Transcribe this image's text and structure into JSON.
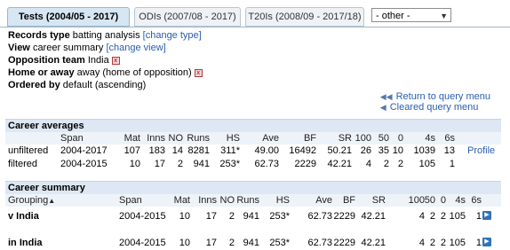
{
  "tabs": {
    "items": [
      {
        "label": "Tests (2004/05 - 2017)",
        "active": true
      },
      {
        "label": "ODIs (2007/08 - 2017)",
        "active": false
      },
      {
        "label": "T20Is (2008/09 - 2017/18)",
        "active": false
      }
    ],
    "select_value": "- other -"
  },
  "query": {
    "records_type_label": "Records type",
    "records_type_value": "batting analysis",
    "records_type_link": "[change type]",
    "view_label": "View",
    "view_value": "career summary",
    "view_link": "[change view]",
    "opposition_label": "Opposition team",
    "opposition_value": "India",
    "home_label": "Home or away",
    "home_value": "away (home of opposition)",
    "ordered_label": "Ordered by",
    "ordered_value": "default (ascending)",
    "return_link": "Return to query menu",
    "cleared_link": "Cleared query menu"
  },
  "career_averages": {
    "title": "Career averages",
    "columns": [
      "Span",
      "Mat",
      "Inns",
      "NO",
      "Runs",
      "HS",
      "Ave",
      "BF",
      "SR",
      "100",
      "50",
      "0",
      "4s",
      "6s"
    ],
    "rows": [
      {
        "label": "unfiltered",
        "values": [
          "2004-2017",
          "107",
          "183",
          "14",
          "8281",
          "311*",
          "49.00",
          "16492",
          "50.21",
          "26",
          "35",
          "10",
          "1039",
          "13"
        ],
        "profile": "Profile"
      },
      {
        "label": "filtered",
        "values": [
          "2004-2015",
          "10",
          "17",
          "2",
          "941",
          "253*",
          "62.73",
          "2229",
          "42.21",
          "4",
          "2",
          "2",
          "105",
          "1"
        ]
      }
    ]
  },
  "career_summary": {
    "title": "Career summary",
    "grouping_label": "Grouping",
    "columns": [
      "Span",
      "Mat",
      "Inns",
      "NO",
      "Runs",
      "HS",
      "Ave",
      "BF",
      "SR",
      "100",
      "50",
      "0",
      "4s",
      "6s"
    ],
    "rows": [
      {
        "label": "v India",
        "values": [
          "2004-2015",
          "10",
          "17",
          "2",
          "941",
          "253*",
          "62.73",
          "2229",
          "42.21",
          "4",
          "2",
          "2",
          "105",
          "1"
        ]
      },
      {
        "label": "in India",
        "values": [
          "2004-2015",
          "10",
          "17",
          "2",
          "941",
          "253*",
          "62.73",
          "2229",
          "42.21",
          "4",
          "2",
          "2",
          "105",
          "1"
        ]
      }
    ]
  }
}
